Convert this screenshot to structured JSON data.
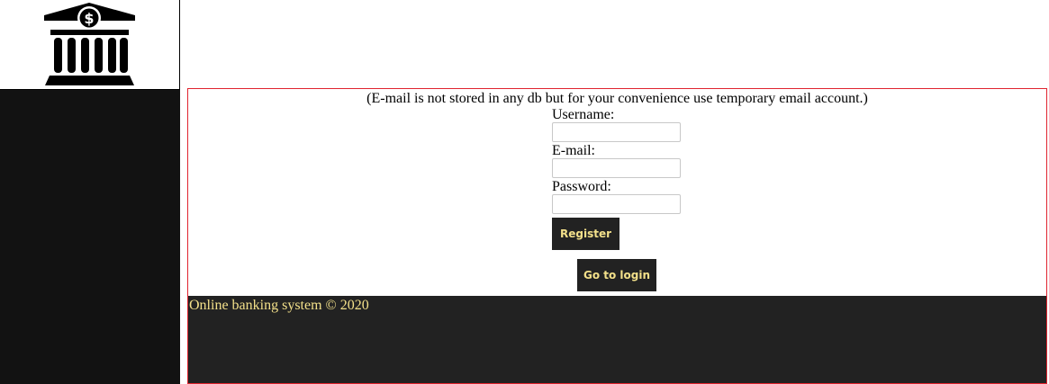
{
  "sidebar": {
    "logo_icon": "bank-dollar-icon"
  },
  "notice": {
    "text": "(E-mail is not stored in any db but for your convenience use temporary email account.)"
  },
  "form": {
    "username_label": "Username:",
    "username_value": "",
    "email_label": "E-mail:",
    "email_value": "",
    "password_label": "Password:",
    "password_value": "",
    "register_label": "Register",
    "login_label": "Go to login"
  },
  "footer": {
    "text": "Online banking system © 2020"
  },
  "colors": {
    "sidebar_bg": "#121212",
    "footer_bg": "#222222",
    "accent_text": "#f3e08a",
    "border": "#e0242f"
  }
}
